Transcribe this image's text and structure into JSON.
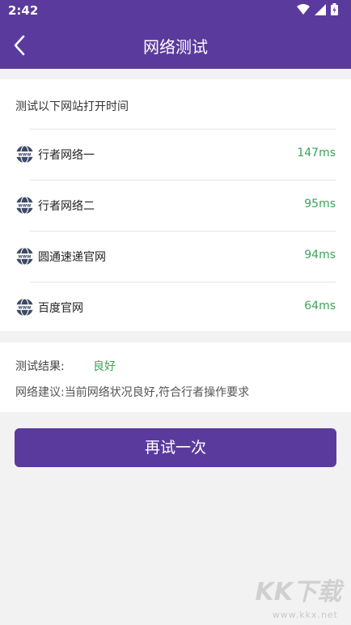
{
  "status_bar": {
    "time": "2:42"
  },
  "header": {
    "title": "网络测试"
  },
  "test_list": {
    "heading": "测试以下网站打开时间",
    "items": [
      {
        "name": "行者网络一",
        "time": "147ms"
      },
      {
        "name": "行者网络二",
        "time": "95ms"
      },
      {
        "name": "圆通速递官网",
        "time": "94ms"
      },
      {
        "name": "百度官网",
        "time": "64ms"
      }
    ]
  },
  "result": {
    "label": "测试结果:",
    "value": "良好",
    "advice": "网络建议:当前网络状况良好,符合行者操作要求"
  },
  "actions": {
    "retry_label": "再试一次"
  },
  "watermark": {
    "logo": "KK下载",
    "url": "www.kkx.net"
  },
  "colors": {
    "primary": "#5b3a9d",
    "good": "#3aa45a",
    "background": "#f2f2f2"
  }
}
